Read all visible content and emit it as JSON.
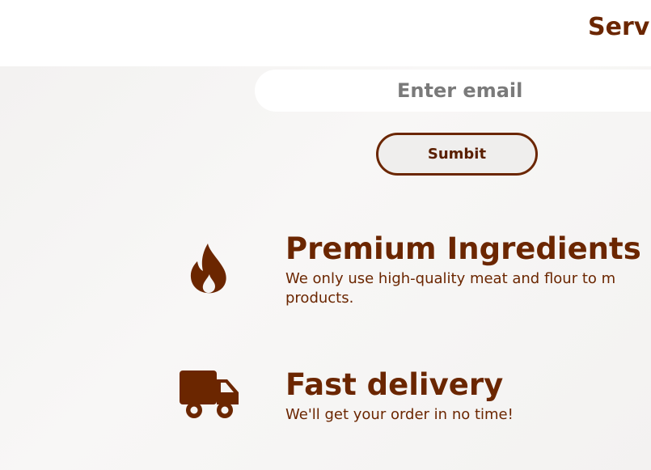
{
  "nav": {
    "link_label": "Servi"
  },
  "newsletter": {
    "email_placeholder": "Enter email",
    "submit_label": "Sumbit"
  },
  "features": [
    {
      "icon": "fire-icon",
      "title": "Premium Ingredients",
      "desc_line1": "We only use high-quality meat and flour to m",
      "desc_line2": "products."
    },
    {
      "icon": "truck-icon",
      "title": "Fast delivery",
      "desc_line1": "We'll get your order in no time!"
    }
  ],
  "colors": {
    "brand": "#6b2600",
    "background": "#f5f4f3",
    "navbar": "#ffffff"
  }
}
